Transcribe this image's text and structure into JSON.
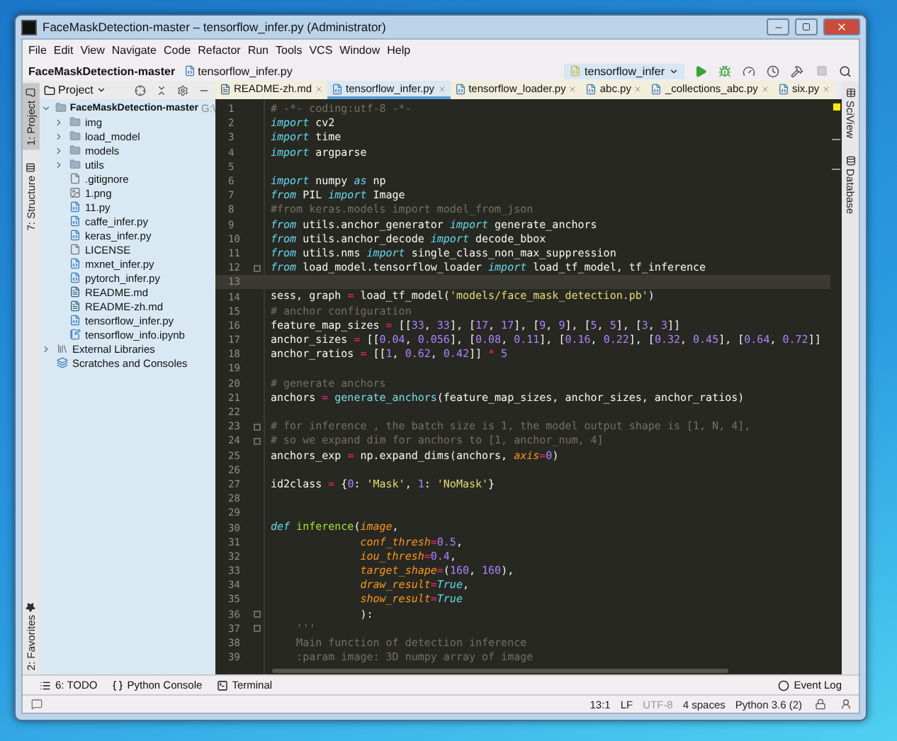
{
  "window": {
    "title": "FaceMaskDetection-master – tensorflow_infer.py (Administrator)"
  },
  "menu": [
    "File",
    "Edit",
    "View",
    "Navigate",
    "Code",
    "Refactor",
    "Run",
    "Tools",
    "VCS",
    "Window",
    "Help"
  ],
  "breadcrumbs": [
    {
      "label": "FaceMaskDetection-master",
      "kind": "project"
    },
    {
      "label": "tensorflow_infer.py",
      "kind": "python"
    }
  ],
  "run_config": {
    "label": "tensorflow_infer"
  },
  "left_stripe": [
    {
      "label": "1: Project",
      "selected": true,
      "kind": "project"
    },
    {
      "label": "7: Structure",
      "selected": false,
      "kind": "structure"
    }
  ],
  "left_stripe_bottom": [
    {
      "label": "2: Favorites",
      "selected": false,
      "kind": "favorites"
    }
  ],
  "right_stripe": [
    {
      "label": "SciView",
      "kind": "sciview"
    },
    {
      "label": "Database",
      "kind": "database"
    }
  ],
  "project_panel": {
    "title": "Project",
    "tree": [
      {
        "label": "FaceMaskDetection-master",
        "path": "G:\\",
        "kind": "folder",
        "expanded": true,
        "children": [
          {
            "label": "img",
            "kind": "folder",
            "expanded": false
          },
          {
            "label": "load_model",
            "kind": "folder",
            "expanded": false
          },
          {
            "label": "models",
            "kind": "folder",
            "expanded": false
          },
          {
            "label": "utils",
            "kind": "folder",
            "expanded": false
          },
          {
            "label": ".gitignore",
            "kind": "text"
          },
          {
            "label": "1.png",
            "kind": "image"
          },
          {
            "label": "11.py",
            "kind": "python"
          },
          {
            "label": "caffe_infer.py",
            "kind": "python"
          },
          {
            "label": "keras_infer.py",
            "kind": "python"
          },
          {
            "label": "LICENSE",
            "kind": "text"
          },
          {
            "label": "mxnet_infer.py",
            "kind": "python"
          },
          {
            "label": "pytorch_infer.py",
            "kind": "python"
          },
          {
            "label": "README.md",
            "kind": "markdown"
          },
          {
            "label": "README-zh.md",
            "kind": "markdown"
          },
          {
            "label": "tensorflow_infer.py",
            "kind": "python"
          },
          {
            "label": "tensorflow_info.ipynb",
            "kind": "notebook"
          }
        ]
      },
      {
        "label": "External Libraries",
        "kind": "library",
        "expanded": false
      },
      {
        "label": "Scratches and Consoles",
        "kind": "scratches"
      }
    ]
  },
  "tabs": [
    {
      "label": "README-zh.md",
      "kind": "markdown",
      "selected": false
    },
    {
      "label": "tensorflow_infer.py",
      "kind": "python",
      "selected": true
    },
    {
      "label": "tensorflow_loader.py",
      "kind": "python",
      "selected": false
    },
    {
      "label": "abc.py",
      "kind": "python",
      "selected": false
    },
    {
      "label": "_collections_abc.py",
      "kind": "python",
      "selected": false
    },
    {
      "label": "six.py",
      "kind": "python",
      "selected": false
    }
  ],
  "editor": {
    "lines": [
      {
        "n": "1",
        "current": false,
        "fold": false,
        "tokens": [
          {
            "kind": "comment",
            "text": "# -*- coding:utf-8 -*-"
          }
        ]
      },
      {
        "n": "2",
        "current": false,
        "fold": false,
        "tokens": [
          {
            "kind": "keyword",
            "text": "import"
          },
          {
            "kind": "plain",
            "text": " cv2"
          }
        ]
      },
      {
        "n": "3",
        "current": false,
        "fold": false,
        "tokens": [
          {
            "kind": "keyword",
            "text": "import"
          },
          {
            "kind": "plain",
            "text": " time"
          }
        ]
      },
      {
        "n": "4",
        "current": false,
        "fold": false,
        "tokens": [
          {
            "kind": "keyword",
            "text": "import"
          },
          {
            "kind": "plain",
            "text": " argparse"
          }
        ]
      },
      {
        "n": "5",
        "current": false,
        "fold": false
      },
      {
        "n": "6",
        "current": false,
        "fold": false,
        "tokens": [
          {
            "kind": "keyword",
            "text": "import"
          },
          {
            "kind": "plain",
            "text": " numpy "
          },
          {
            "kind": "keyword",
            "text": "as"
          },
          {
            "kind": "plain",
            "text": " np"
          }
        ]
      },
      {
        "n": "7",
        "current": false,
        "fold": false,
        "tokens": [
          {
            "kind": "keyword",
            "text": "from"
          },
          {
            "kind": "plain",
            "text": " PIL "
          },
          {
            "kind": "keyword",
            "text": "import"
          },
          {
            "kind": "plain",
            "text": " Image"
          }
        ]
      },
      {
        "n": "8",
        "current": false,
        "fold": false,
        "tokens": [
          {
            "kind": "comment",
            "text": "#from keras.models import model_from_json"
          }
        ]
      },
      {
        "n": "9",
        "current": false,
        "fold": false,
        "tokens": [
          {
            "kind": "keyword",
            "text": "from"
          },
          {
            "kind": "plain",
            "text": " utils.anchor_generator "
          },
          {
            "kind": "keyword",
            "text": "import"
          },
          {
            "kind": "plain",
            "text": " generate_anchors"
          }
        ]
      },
      {
        "n": "10",
        "current": false,
        "fold": false,
        "tokens": [
          {
            "kind": "keyword",
            "text": "from"
          },
          {
            "kind": "plain",
            "text": " utils.anchor_decode "
          },
          {
            "kind": "keyword",
            "text": "import"
          },
          {
            "kind": "plain",
            "text": " decode_bbox"
          }
        ]
      },
      {
        "n": "11",
        "current": false,
        "fold": false,
        "tokens": [
          {
            "kind": "keyword",
            "text": "from"
          },
          {
            "kind": "plain",
            "text": " utils.nms "
          },
          {
            "kind": "keyword",
            "text": "import"
          },
          {
            "kind": "plain",
            "text": " single_class_non_max_suppression"
          }
        ]
      },
      {
        "n": "12",
        "current": false,
        "fold": true,
        "tokens": [
          {
            "kind": "keyword",
            "text": "from"
          },
          {
            "kind": "plain",
            "text": " load_model.tensorflow_loader "
          },
          {
            "kind": "keyword",
            "text": "import"
          },
          {
            "kind": "plain",
            "text": " load_tf_model, tf_inference"
          }
        ]
      },
      {
        "n": "13",
        "current": true,
        "fold": false
      },
      {
        "n": "14",
        "current": false,
        "fold": false,
        "tokens": [
          {
            "kind": "plain",
            "text": "sess, graph "
          },
          {
            "kind": "operator",
            "text": "="
          },
          {
            "kind": "plain",
            "text": " load_tf_model("
          },
          {
            "kind": "string",
            "text": "'models/face_mask_detection.pb'"
          },
          {
            "kind": "plain",
            "text": ")"
          }
        ]
      },
      {
        "n": "15",
        "current": false,
        "fold": false,
        "tokens": [
          {
            "kind": "comment",
            "text": "# anchor configuration"
          }
        ]
      },
      {
        "n": "16",
        "current": false,
        "fold": false,
        "tokens": [
          {
            "kind": "plain",
            "text": "feature_map_sizes "
          },
          {
            "kind": "operator",
            "text": "="
          },
          {
            "kind": "plain",
            "text": " [["
          },
          {
            "kind": "number",
            "text": "33"
          },
          {
            "kind": "plain",
            "text": ", "
          },
          {
            "kind": "number",
            "text": "33"
          },
          {
            "kind": "plain",
            "text": "], ["
          },
          {
            "kind": "number",
            "text": "17"
          },
          {
            "kind": "plain",
            "text": ", "
          },
          {
            "kind": "number",
            "text": "17"
          },
          {
            "kind": "plain",
            "text": "], ["
          },
          {
            "kind": "number",
            "text": "9"
          },
          {
            "kind": "plain",
            "text": ", "
          },
          {
            "kind": "number",
            "text": "9"
          },
          {
            "kind": "plain",
            "text": "], ["
          },
          {
            "kind": "number",
            "text": "5"
          },
          {
            "kind": "plain",
            "text": ", "
          },
          {
            "kind": "number",
            "text": "5"
          },
          {
            "kind": "plain",
            "text": "], ["
          },
          {
            "kind": "number",
            "text": "3"
          },
          {
            "kind": "plain",
            "text": ", "
          },
          {
            "kind": "number",
            "text": "3"
          },
          {
            "kind": "plain",
            "text": "]]"
          }
        ]
      },
      {
        "n": "17",
        "current": false,
        "fold": false,
        "tokens": [
          {
            "kind": "plain",
            "text": "anchor_sizes "
          },
          {
            "kind": "operator",
            "text": "="
          },
          {
            "kind": "plain",
            "text": " [["
          },
          {
            "kind": "number",
            "text": "0.04"
          },
          {
            "kind": "plain",
            "text": ", "
          },
          {
            "kind": "number",
            "text": "0.056"
          },
          {
            "kind": "plain",
            "text": "], ["
          },
          {
            "kind": "number",
            "text": "0.08"
          },
          {
            "kind": "plain",
            "text": ", "
          },
          {
            "kind": "number",
            "text": "0.11"
          },
          {
            "kind": "plain",
            "text": "], ["
          },
          {
            "kind": "number",
            "text": "0.16"
          },
          {
            "kind": "plain",
            "text": ", "
          },
          {
            "kind": "number",
            "text": "0.22"
          },
          {
            "kind": "plain",
            "text": "], ["
          },
          {
            "kind": "number",
            "text": "0.32"
          },
          {
            "kind": "plain",
            "text": ", "
          },
          {
            "kind": "number",
            "text": "0.45"
          },
          {
            "kind": "plain",
            "text": "], ["
          },
          {
            "kind": "number",
            "text": "0.64"
          },
          {
            "kind": "plain",
            "text": ", "
          },
          {
            "kind": "number",
            "text": "0.72"
          },
          {
            "kind": "plain",
            "text": "]]"
          }
        ]
      },
      {
        "n": "18",
        "current": false,
        "fold": false,
        "tokens": [
          {
            "kind": "plain",
            "text": "anchor_ratios "
          },
          {
            "kind": "operator",
            "text": "="
          },
          {
            "kind": "plain",
            "text": " [["
          },
          {
            "kind": "number",
            "text": "1"
          },
          {
            "kind": "plain",
            "text": ", "
          },
          {
            "kind": "number",
            "text": "0.62"
          },
          {
            "kind": "plain",
            "text": ", "
          },
          {
            "kind": "number",
            "text": "0.42"
          },
          {
            "kind": "plain",
            "text": "]] "
          },
          {
            "kind": "operator",
            "text": "*"
          },
          {
            "kind": "number",
            "text": " 5"
          }
        ]
      },
      {
        "n": "19",
        "current": false,
        "fold": false
      },
      {
        "n": "20",
        "current": false,
        "fold": false,
        "tokens": [
          {
            "kind": "comment",
            "text": "# generate anchors"
          }
        ]
      },
      {
        "n": "21",
        "current": false,
        "fold": false,
        "tokens": [
          {
            "kind": "plain",
            "text": "anchors "
          },
          {
            "kind": "operator",
            "text": "="
          },
          {
            "kind": "call",
            "text": " generate_anchors"
          },
          {
            "kind": "plain",
            "text": "(feature_map_sizes, anchor_sizes, anchor_ratios)"
          }
        ]
      },
      {
        "n": "22",
        "current": false,
        "fold": false
      },
      {
        "n": "23",
        "current": false,
        "fold": true,
        "tokens": [
          {
            "kind": "comment",
            "text": "# for inference , the batch size is 1, the model output shape is [1, N, 4],"
          }
        ]
      },
      {
        "n": "24",
        "current": false,
        "fold": true,
        "tokens": [
          {
            "kind": "comment",
            "text": "# so we expand dim for anchors to [1, anchor_num, 4]"
          }
        ]
      },
      {
        "n": "25",
        "current": false,
        "fold": false,
        "tokens": [
          {
            "kind": "plain",
            "text": "anchors_exp "
          },
          {
            "kind": "operator",
            "text": "="
          },
          {
            "kind": "plain",
            "text": " np.expand_dims(anchors, "
          },
          {
            "kind": "param",
            "text": "axis"
          },
          {
            "kind": "operator",
            "text": "="
          },
          {
            "kind": "number",
            "text": "0"
          },
          {
            "kind": "plain",
            "text": ")"
          }
        ]
      },
      {
        "n": "26",
        "current": false,
        "fold": false
      },
      {
        "n": "27",
        "current": false,
        "fold": false,
        "tokens": [
          {
            "kind": "plain",
            "text": "id2class "
          },
          {
            "kind": "operator",
            "text": "="
          },
          {
            "kind": "plain",
            "text": " {"
          },
          {
            "kind": "number",
            "text": "0"
          },
          {
            "kind": "plain",
            "text": ": "
          },
          {
            "kind": "string",
            "text": "'Mask'"
          },
          {
            "kind": "plain",
            "text": ", "
          },
          {
            "kind": "number",
            "text": "1"
          },
          {
            "kind": "plain",
            "text": ": "
          },
          {
            "kind": "string",
            "text": "'NoMask'"
          },
          {
            "kind": "plain",
            "text": "}"
          }
        ]
      },
      {
        "n": "28",
        "current": false,
        "fold": false
      },
      {
        "n": "29",
        "current": false,
        "fold": false
      },
      {
        "n": "30",
        "current": false,
        "fold": false,
        "tokens": [
          {
            "kind": "keyword",
            "text": "def"
          },
          {
            "kind": "function",
            "text": " inference"
          },
          {
            "kind": "plain",
            "text": "("
          },
          {
            "kind": "param",
            "text": "image"
          },
          {
            "kind": "plain",
            "text": ","
          }
        ]
      },
      {
        "n": "31",
        "current": false,
        "fold": false,
        "tokens": [
          {
            "kind": "param",
            "text": "              conf_thresh"
          },
          {
            "kind": "operator",
            "text": "="
          },
          {
            "kind": "number",
            "text": "0.5"
          },
          {
            "kind": "plain",
            "text": ","
          }
        ]
      },
      {
        "n": "32",
        "current": false,
        "fold": false,
        "tokens": [
          {
            "kind": "param",
            "text": "              iou_thresh"
          },
          {
            "kind": "operator",
            "text": "="
          },
          {
            "kind": "number",
            "text": "0.4"
          },
          {
            "kind": "plain",
            "text": ","
          }
        ]
      },
      {
        "n": "33",
        "current": false,
        "fold": false,
        "tokens": [
          {
            "kind": "param",
            "text": "              target_shape"
          },
          {
            "kind": "operator",
            "text": "="
          },
          {
            "kind": "plain",
            "text": "("
          },
          {
            "kind": "number",
            "text": "160"
          },
          {
            "kind": "plain",
            "text": ", "
          },
          {
            "kind": "number",
            "text": "160"
          },
          {
            "kind": "plain",
            "text": "),"
          }
        ]
      },
      {
        "n": "34",
        "current": false,
        "fold": false,
        "tokens": [
          {
            "kind": "param",
            "text": "              draw_result"
          },
          {
            "kind": "operator",
            "text": "="
          },
          {
            "kind": "constant",
            "text": "True"
          },
          {
            "kind": "plain",
            "text": ","
          }
        ]
      },
      {
        "n": "35",
        "current": false,
        "fold": false,
        "tokens": [
          {
            "kind": "param",
            "text": "              show_result"
          },
          {
            "kind": "operator",
            "text": "="
          },
          {
            "kind": "constant",
            "text": "True"
          }
        ]
      },
      {
        "n": "36",
        "current": false,
        "fold": true,
        "tokens": [
          {
            "kind": "plain",
            "text": "              ):"
          }
        ]
      },
      {
        "n": "37",
        "current": false,
        "fold": true,
        "tokens": [
          {
            "kind": "comment",
            "text": "    '''"
          }
        ]
      },
      {
        "n": "38",
        "current": false,
        "fold": false,
        "tokens": [
          {
            "kind": "comment",
            "text": "    Main function of detection inference"
          }
        ]
      },
      {
        "n": "39",
        "current": false,
        "fold": false,
        "tokens": [
          {
            "kind": "comment",
            "text": "    :param image: 3D numpy array of image"
          }
        ]
      }
    ]
  },
  "bottom_tools": [
    {
      "label": "6: TODO",
      "kind": "todo"
    },
    {
      "label": "Python Console",
      "kind": "console"
    },
    {
      "label": "Terminal",
      "kind": "terminal"
    }
  ],
  "event_log": {
    "label": "Event Log"
  },
  "status_bar": [
    {
      "label": "13:1",
      "disabled": false
    },
    {
      "label": "LF",
      "disabled": false
    },
    {
      "label": "UTF-8",
      "disabled": true
    },
    {
      "label": "4 spaces",
      "disabled": false
    },
    {
      "label": "Python 3.6 (2)",
      "disabled": false
    }
  ]
}
